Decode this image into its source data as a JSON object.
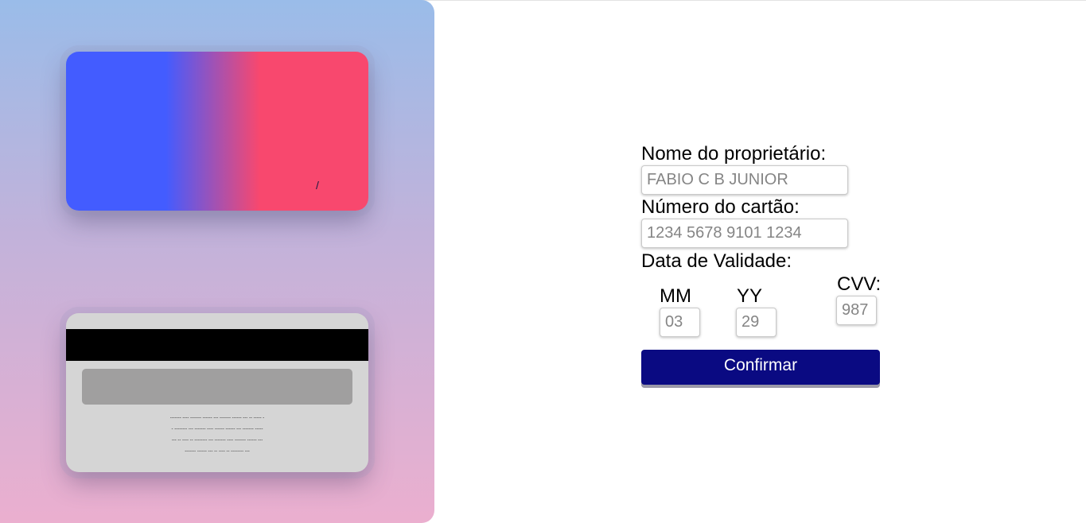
{
  "card_front": {
    "expiry_separator": "/"
  },
  "card_back": {
    "fine_print_lines": [
      "------- ---- ------- ------ --- ------- ------ --- -- ----- -",
      "- -------- --- ------- ---- ------ ------ --- ------- -----",
      "--- -- ---- -- -------- --- ------- ---- ------- ------ ---",
      "------- ------ --- -- ---- -- -------- ---"
    ]
  },
  "form": {
    "owner": {
      "label": "Nome do proprietário:",
      "placeholder": "FABIO C B JUNIOR",
      "value": ""
    },
    "number": {
      "label": "Número do cartão:",
      "placeholder": "1234 5678 9101 1234",
      "value": ""
    },
    "validity_label": "Data de Validade:",
    "month": {
      "label": "MM",
      "placeholder": "03",
      "value": ""
    },
    "year": {
      "label": "YY",
      "placeholder": "29",
      "value": ""
    },
    "cvv": {
      "label": "CVV:",
      "placeholder": "987",
      "value": ""
    },
    "submit_label": "Confirmar"
  },
  "colors": {
    "panel_gradient_top": "#9abce9",
    "panel_gradient_bottom": "#ebafcf",
    "card_blue": "#435cff",
    "card_pink": "#f8486e",
    "button": "#0a0a82"
  }
}
